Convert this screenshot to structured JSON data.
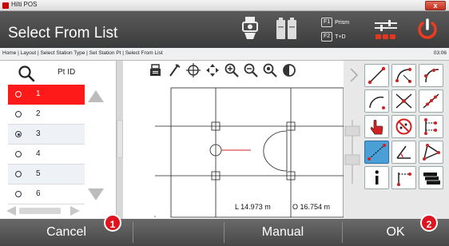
{
  "window": {
    "title": "Hilti POS",
    "close_glyph": "x"
  },
  "header": {
    "title": "Select From List",
    "f1": {
      "key": "F1",
      "label": "Prism"
    },
    "f2": {
      "key": "F2",
      "label": "T+D"
    },
    "icons": [
      "instrument-icon",
      "battery-icon",
      "settings-sliders-icon",
      "power-icon"
    ]
  },
  "breadcrumb": {
    "path": "Home | Layout | Select Station Type | Set Station Pt | Select From List",
    "time": "03:06"
  },
  "list": {
    "column_header": "Pt ID",
    "items": [
      {
        "id": "1",
        "selected_row": true,
        "radio": false
      },
      {
        "id": "2",
        "selected_row": false,
        "radio": false
      },
      {
        "id": "3",
        "selected_row": false,
        "radio": true
      },
      {
        "id": "4",
        "selected_row": false,
        "radio": false
      },
      {
        "id": "5",
        "selected_row": false,
        "radio": false
      },
      {
        "id": "6",
        "selected_row": false,
        "radio": false
      }
    ]
  },
  "drawing": {
    "length_readout": "L 14.973 m",
    "offset_readout": "O 16.754 m"
  },
  "footer": {
    "cancel": "Cancel",
    "manual": "Manual",
    "ok": "OK",
    "badge_1": "1",
    "badge_2": "2"
  },
  "colors": {
    "selected_row": "#ff1a1a",
    "badge": "#e0141e",
    "tool_icon_red": "#d42020",
    "tool_highlight": "#4a9fd6"
  }
}
